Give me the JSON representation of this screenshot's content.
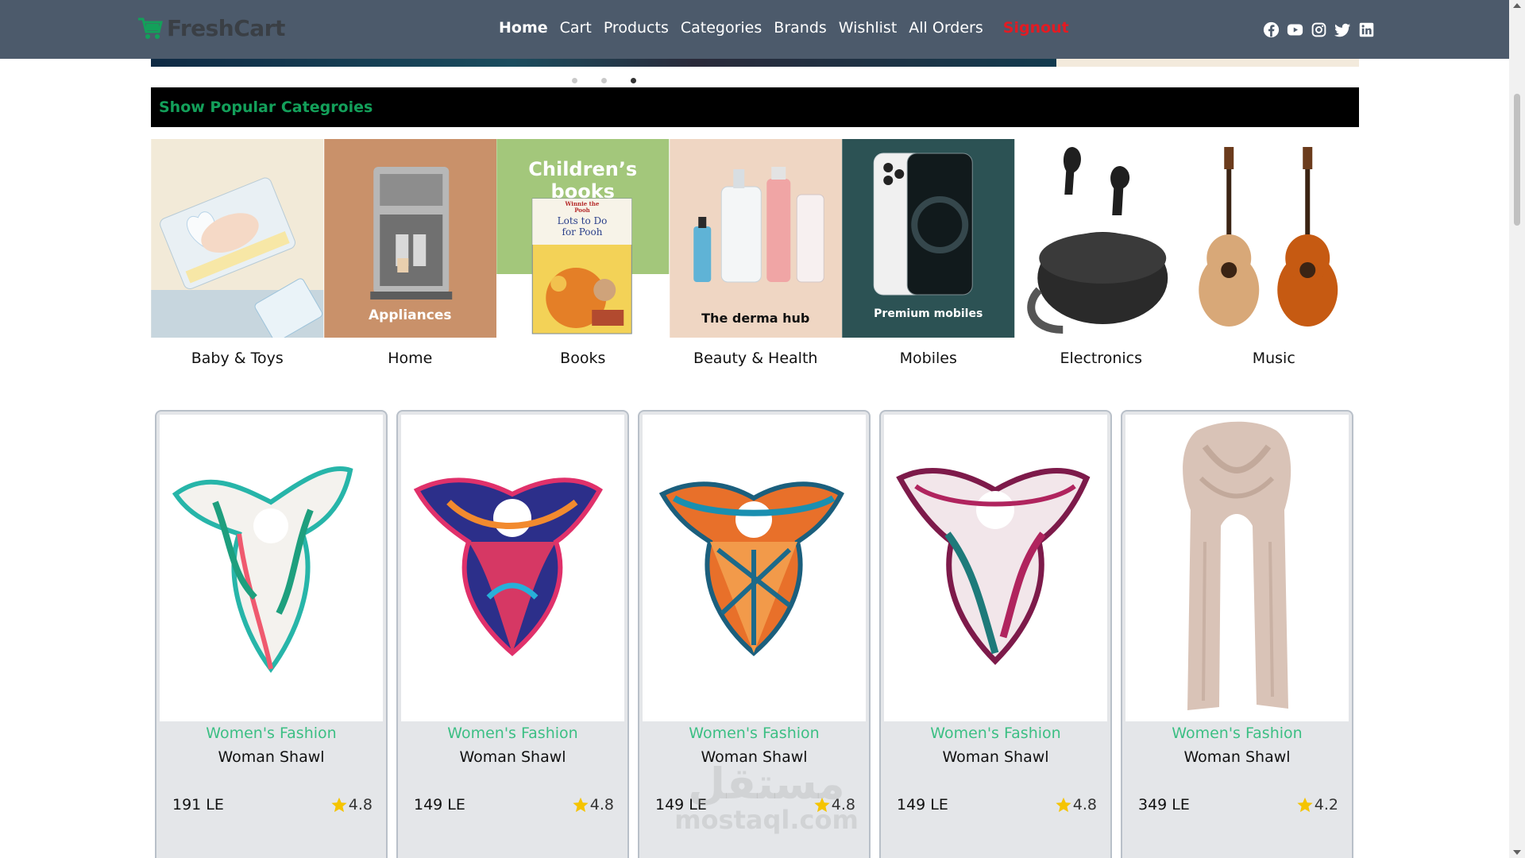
{
  "brand": {
    "name": "FreshCart",
    "accent": "#13a05a",
    "navbar_bg": "#4c5a6b",
    "signout_color": "#e31b23"
  },
  "nav": {
    "links": [
      {
        "label": "Home",
        "active": true
      },
      {
        "label": "Cart"
      },
      {
        "label": "Products"
      },
      {
        "label": "Categories"
      },
      {
        "label": "Brands"
      },
      {
        "label": "Wishlist"
      },
      {
        "label": "All Orders"
      }
    ],
    "signout": "Signout",
    "social_icons": [
      "facebook-icon",
      "youtube-icon",
      "instagram-icon",
      "twitter-icon",
      "linkedin-icon"
    ]
  },
  "slider": {
    "dot_count": 3,
    "active_dot": 3
  },
  "popular": {
    "title": "Show Popular Categroies",
    "categories": [
      {
        "label": "Baby & Toys",
        "image_text": ""
      },
      {
        "label": "Home",
        "image_text": "Appliances"
      },
      {
        "label": "Books",
        "image_text": "Children’s books",
        "book_title": "Lots to Do for Pooh",
        "book_brand": "Winnie the Pooh"
      },
      {
        "label": "Beauty & Health",
        "image_text": "The derma hub"
      },
      {
        "label": "Mobiles",
        "image_text": "Premium mobiles"
      },
      {
        "label": "Electronics",
        "image_text": ""
      },
      {
        "label": "Music",
        "image_text": ""
      }
    ]
  },
  "products": [
    {
      "category": "Women's Fashion",
      "title": "Woman Shawl",
      "price": "191 LE",
      "rating": "4.8"
    },
    {
      "category": "Women's Fashion",
      "title": "Woman Shawl",
      "price": "149 LE",
      "rating": "4.8"
    },
    {
      "category": "Women's Fashion",
      "title": "Woman Shawl",
      "price": "149 LE",
      "rating": "4.8"
    },
    {
      "category": "Women's Fashion",
      "title": "Woman Shawl",
      "price": "149 LE",
      "rating": "4.8"
    },
    {
      "category": "Women's Fashion",
      "title": "Woman Shawl",
      "price": "349 LE",
      "rating": "4.2"
    }
  ],
  "watermark": {
    "arabic": "مستقل",
    "latin": "mostaql.com"
  }
}
